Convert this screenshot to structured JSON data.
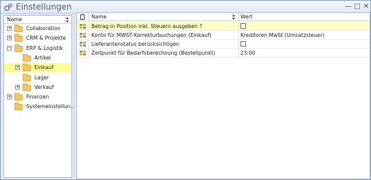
{
  "window": {
    "title": "Einstellungen",
    "controls": {
      "minimize": "—",
      "maximize": "□",
      "close": "✕"
    }
  },
  "tree": {
    "header": "Name",
    "items": [
      {
        "label": "Collaboration",
        "expander": "+",
        "level": 0,
        "selected": false
      },
      {
        "label": "CRM & Projekte",
        "expander": "+",
        "level": 0,
        "selected": false
      },
      {
        "label": "ERP & Logistik",
        "expander": "−",
        "level": 0,
        "selected": false
      },
      {
        "label": "Artikel",
        "expander": "",
        "level": 1,
        "selected": false
      },
      {
        "label": "Einkauf",
        "expander": "+",
        "level": 1,
        "selected": true
      },
      {
        "label": "Lager",
        "expander": "",
        "level": 1,
        "selected": false
      },
      {
        "label": "Verkauf",
        "expander": "+",
        "level": 1,
        "selected": false
      },
      {
        "label": "Finanzen",
        "expander": "+",
        "level": 0,
        "selected": false
      },
      {
        "label": "Systemeinstellun...",
        "expander": "",
        "level": 0,
        "selected": false
      }
    ]
  },
  "grid": {
    "columns": {
      "name": "Name",
      "value": "Wert"
    },
    "rows": [
      {
        "name": "Betrag in Position inkl. Steuern ausgeben ?",
        "type": "checkbox",
        "value": "",
        "checked": false,
        "highlight": true
      },
      {
        "name": "Konto für MWST-Korrekturbuchungen (Einkauf)",
        "type": "text",
        "value": "Kreditoren MwSt (Umsatzsteuer)",
        "highlight": false
      },
      {
        "name": "Lieferantenstatus berücksichtigen",
        "type": "checkbox",
        "value": "",
        "checked": false,
        "highlight": false
      },
      {
        "name": "Zeitpunkt für Bedarfsberechnung (Bestellpunkt)",
        "type": "text",
        "value": "23:00",
        "highlight": false
      }
    ]
  },
  "colors": {
    "selection": "#fdfd99",
    "row_highlight": "#fdfdc4",
    "folder": "#f2c76a",
    "window_bg": "#e3ebf6"
  }
}
